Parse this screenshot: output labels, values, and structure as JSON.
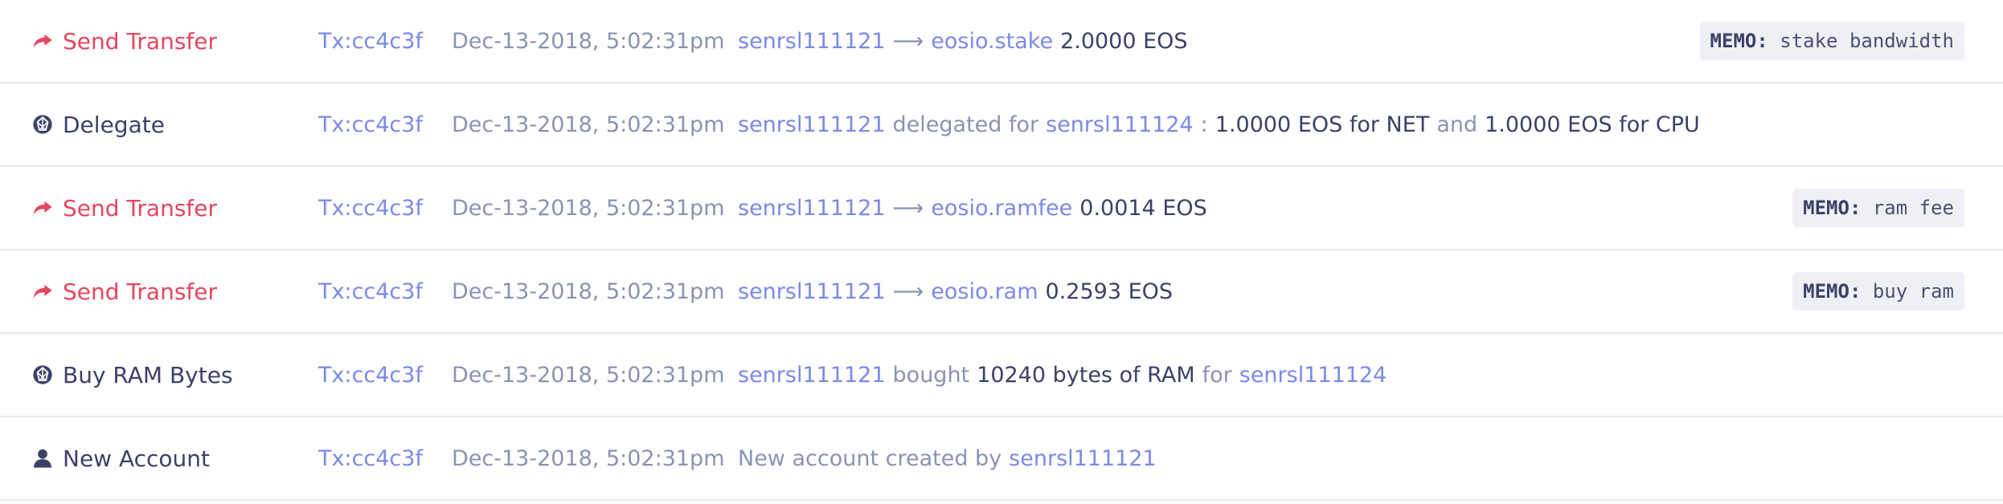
{
  "colors": {
    "transfer": "#e5465f",
    "link": "#7b89e8",
    "muted": "#8a93b3",
    "dark": "#3b4168"
  },
  "rows": [
    {
      "icon": "send-arrow-icon",
      "action": "Send Transfer",
      "tx": "Tx:cc4c3f",
      "date": "Dec-13-2018, 5:02:31pm",
      "from": "senrsl111121",
      "arrow": "⟶",
      "to": "eosio.stake",
      "amount": "2.0000 EOS",
      "memo_key": "MEMO:",
      "memo_value": "stake bandwidth"
    },
    {
      "icon": "eos-icon",
      "action": "Delegate",
      "tx": "Tx:cc4c3f",
      "date": "Dec-13-2018, 5:02:31pm",
      "from": "senrsl111121",
      "verb": "delegated for",
      "to": "senrsl111124",
      "colon": ":",
      "net": "1.0000 EOS for NET",
      "and": "and",
      "cpu": "1.0000 EOS for CPU"
    },
    {
      "icon": "send-arrow-icon",
      "action": "Send Transfer",
      "tx": "Tx:cc4c3f",
      "date": "Dec-13-2018, 5:02:31pm",
      "from": "senrsl111121",
      "arrow": "⟶",
      "to": "eosio.ramfee",
      "amount": "0.0014 EOS",
      "memo_key": "MEMO:",
      "memo_value": "ram fee"
    },
    {
      "icon": "send-arrow-icon",
      "action": "Send Transfer",
      "tx": "Tx:cc4c3f",
      "date": "Dec-13-2018, 5:02:31pm",
      "from": "senrsl111121",
      "arrow": "⟶",
      "to": "eosio.ram",
      "amount": "0.2593 EOS",
      "memo_key": "MEMO:",
      "memo_value": "buy ram"
    },
    {
      "icon": "eos-icon",
      "action": "Buy RAM Bytes",
      "tx": "Tx:cc4c3f",
      "date": "Dec-13-2018, 5:02:31pm",
      "from": "senrsl111121",
      "verb": "bought",
      "bytes": "10240 bytes of RAM",
      "for": "for",
      "to": "senrsl111124"
    },
    {
      "icon": "user-icon",
      "action": "New Account",
      "tx": "Tx:cc4c3f",
      "date": "Dec-13-2018, 5:02:31pm",
      "prefix": "New account created by",
      "from": "senrsl111121"
    }
  ]
}
